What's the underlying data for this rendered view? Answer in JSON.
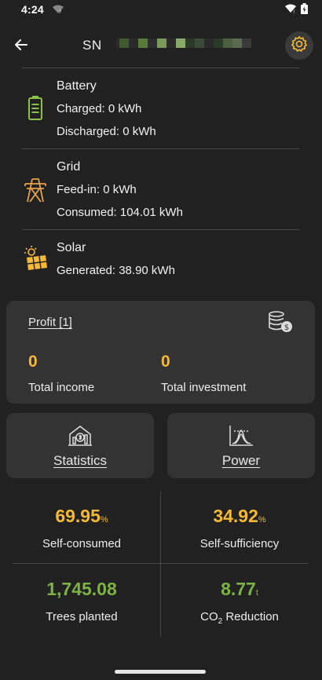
{
  "status_bar": {
    "time": "4:24"
  },
  "header": {
    "sn_label": "SN"
  },
  "energy": {
    "battery": {
      "title": "Battery",
      "charged": "Charged: 0 kWh",
      "discharged": "Discharged: 0 kWh"
    },
    "grid": {
      "title": "Grid",
      "feed_in": "Feed-in: 0 kWh",
      "consumed": "Consumed: 104.01 kWh"
    },
    "solar": {
      "title": "Solar",
      "generated": "Generated: 38.90 kWh"
    }
  },
  "profit": {
    "title": "Profit [1]",
    "income_value": "0",
    "income_label": "Total income",
    "investment_value": "0",
    "investment_label": "Total investment"
  },
  "nav": {
    "statistics": "Statistics",
    "power": "Power"
  },
  "stats": {
    "self_consumed": {
      "value": "69.95",
      "unit": "%",
      "label": "Self-consumed"
    },
    "self_sufficiency": {
      "value": "34.92",
      "unit": "%",
      "label": "Self-sufficiency"
    },
    "trees": {
      "value": "1,745.08",
      "label": "Trees planted"
    },
    "co2": {
      "value": "8.77",
      "unit": "t",
      "label_main": "CO",
      "label_sub": "2",
      "label_rest": " Reduction"
    }
  },
  "colors": {
    "accent_yellow": "#f5b935",
    "accent_green": "#7cb342",
    "background": "#212121",
    "card": "#333333",
    "icon_orange": "#e8a24a",
    "icon_green": "#8bc34a"
  },
  "icons": [
    "wifi-icon",
    "signal-icon",
    "battery-icon",
    "back-arrow-icon",
    "settings-gear-icon",
    "battery-device-icon",
    "grid-tower-icon",
    "solar-panel-icon",
    "coins-icon",
    "statistics-icon",
    "power-curve-icon"
  ]
}
